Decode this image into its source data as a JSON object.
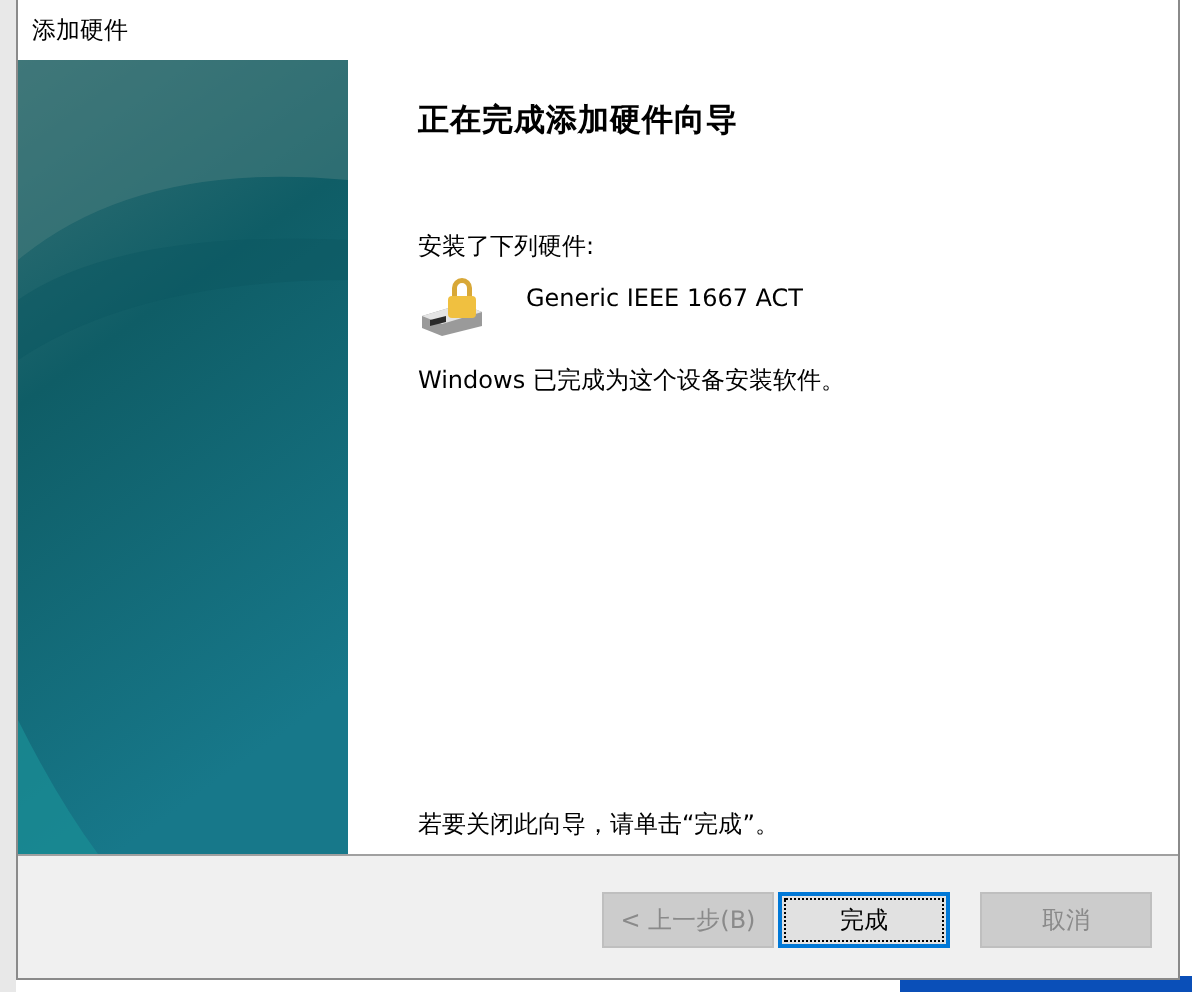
{
  "window": {
    "title": "添加硬件"
  },
  "heading": "正在完成添加硬件向导",
  "installed_label": "安装了下列硬件:",
  "devices": [
    {
      "name": "Generic IEEE 1667 ACT"
    }
  ],
  "message": "Windows 已完成为这个设备安装软件。",
  "footer_note": "若要关闭此向导，请单击“完成”。",
  "buttons": [
    {
      "label": "< 上一步(B)",
      "disabled": true,
      "default": false
    },
    {
      "label": "完成",
      "disabled": false,
      "default": true
    },
    {
      "label": "取消",
      "disabled": true,
      "default": false
    }
  ]
}
